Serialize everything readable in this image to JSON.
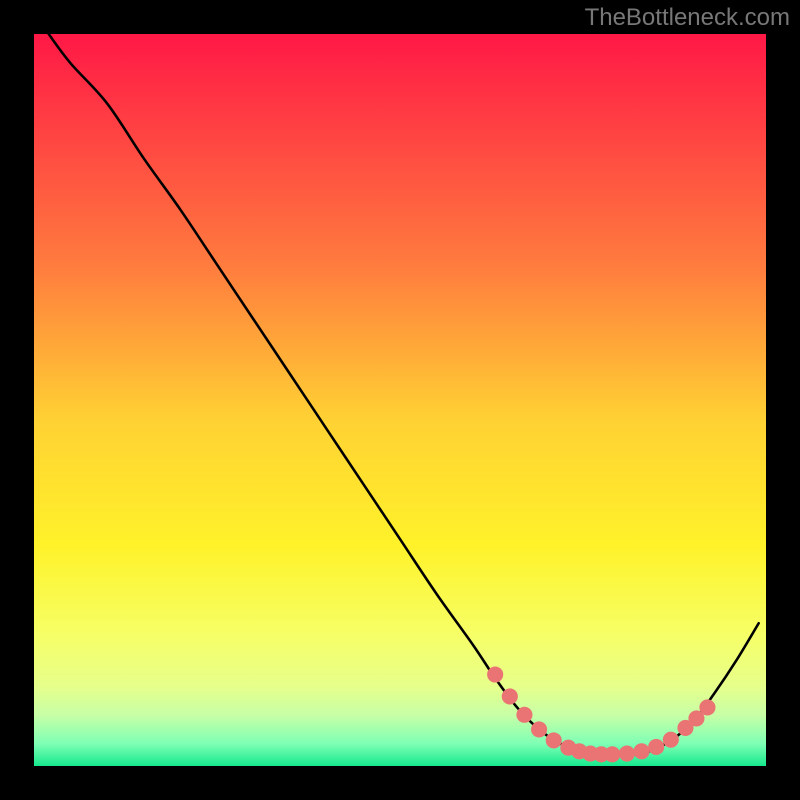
{
  "watermark": "TheBottleneck.com",
  "chart_data": {
    "type": "line",
    "title": "",
    "xlabel": "",
    "ylabel": "",
    "xlim": [
      0,
      100
    ],
    "ylim": [
      0,
      100
    ],
    "background_gradient": {
      "stops": [
        {
          "offset": 0.0,
          "color": "#ff1846"
        },
        {
          "offset": 0.32,
          "color": "#ff7d3e"
        },
        {
          "offset": 0.53,
          "color": "#ffd233"
        },
        {
          "offset": 0.7,
          "color": "#fff22a"
        },
        {
          "offset": 0.82,
          "color": "#f6ff66"
        },
        {
          "offset": 0.89,
          "color": "#e7ff8a"
        },
        {
          "offset": 0.93,
          "color": "#c8ffa6"
        },
        {
          "offset": 0.97,
          "color": "#7dffb5"
        },
        {
          "offset": 1.0,
          "color": "#16e98d"
        }
      ]
    },
    "series": [
      {
        "name": "bottleneck-curve",
        "color": "#000000",
        "x": [
          2,
          5,
          10,
          15,
          20,
          25,
          30,
          35,
          40,
          45,
          50,
          55,
          60,
          63,
          66,
          69,
          72,
          75,
          78,
          81,
          84,
          87,
          90,
          93,
          96,
          99
        ],
        "y": [
          100,
          96,
          90.5,
          83,
          76,
          68.5,
          61,
          53.5,
          46,
          38.5,
          31,
          23.5,
          16.5,
          12,
          8,
          5,
          3,
          2,
          1.5,
          1.5,
          2,
          3.5,
          6,
          10,
          14.5,
          19.5
        ]
      }
    ],
    "markers": {
      "name": "bottleneck-markers",
      "color": "#ea7474",
      "radius": 1.1,
      "x": [
        63,
        65,
        67,
        69,
        71,
        73,
        74.5,
        76,
        77.5,
        79,
        81,
        83,
        85,
        87,
        89,
        90.5,
        92
      ],
      "y": [
        12.5,
        9.5,
        7,
        5,
        3.5,
        2.5,
        2,
        1.7,
        1.6,
        1.6,
        1.7,
        2,
        2.6,
        3.6,
        5.2,
        6.5,
        8
      ]
    }
  }
}
